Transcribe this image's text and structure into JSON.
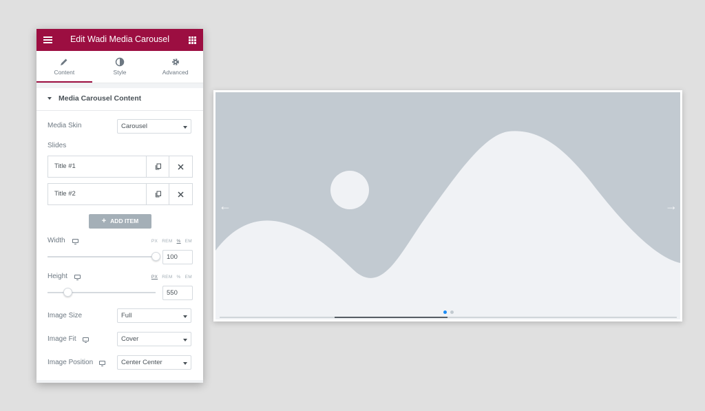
{
  "header": {
    "title": "Edit Wadi Media Carousel"
  },
  "tabs": [
    {
      "label": "Content",
      "icon": "pencil-icon"
    },
    {
      "label": "Style",
      "icon": "half-circle-icon"
    },
    {
      "label": "Advanced",
      "icon": "gear-icon"
    }
  ],
  "section": {
    "title": "Media Carousel Content"
  },
  "media_skin": {
    "label": "Media Skin",
    "value": "Carousel"
  },
  "slides": {
    "label": "Slides",
    "items": [
      {
        "title": "Title #1"
      },
      {
        "title": "Title #2"
      }
    ],
    "add_label": "ADD ITEM"
  },
  "width": {
    "label": "Width",
    "units": [
      "PX",
      "REM",
      "%",
      "EM"
    ],
    "value": "100"
  },
  "height": {
    "label": "Height",
    "units": [
      "PX",
      "REM",
      "%",
      "EM"
    ],
    "value": "550"
  },
  "image_size": {
    "label": "Image Size",
    "value": "Full"
  },
  "image_fit": {
    "label": "Image Fit",
    "value": "Cover"
  },
  "image_position": {
    "label": "Image Position",
    "value": "Center Center"
  },
  "preview": {
    "arrow_left": "←",
    "arrow_right": "→",
    "dots": 2,
    "active_dot": 0
  },
  "colors": {
    "brand": "#9c0e41",
    "placeholder_bg": "#c2cad1",
    "placeholder_fg": "#f0f2f5",
    "dot_active": "#1a8bf5"
  }
}
